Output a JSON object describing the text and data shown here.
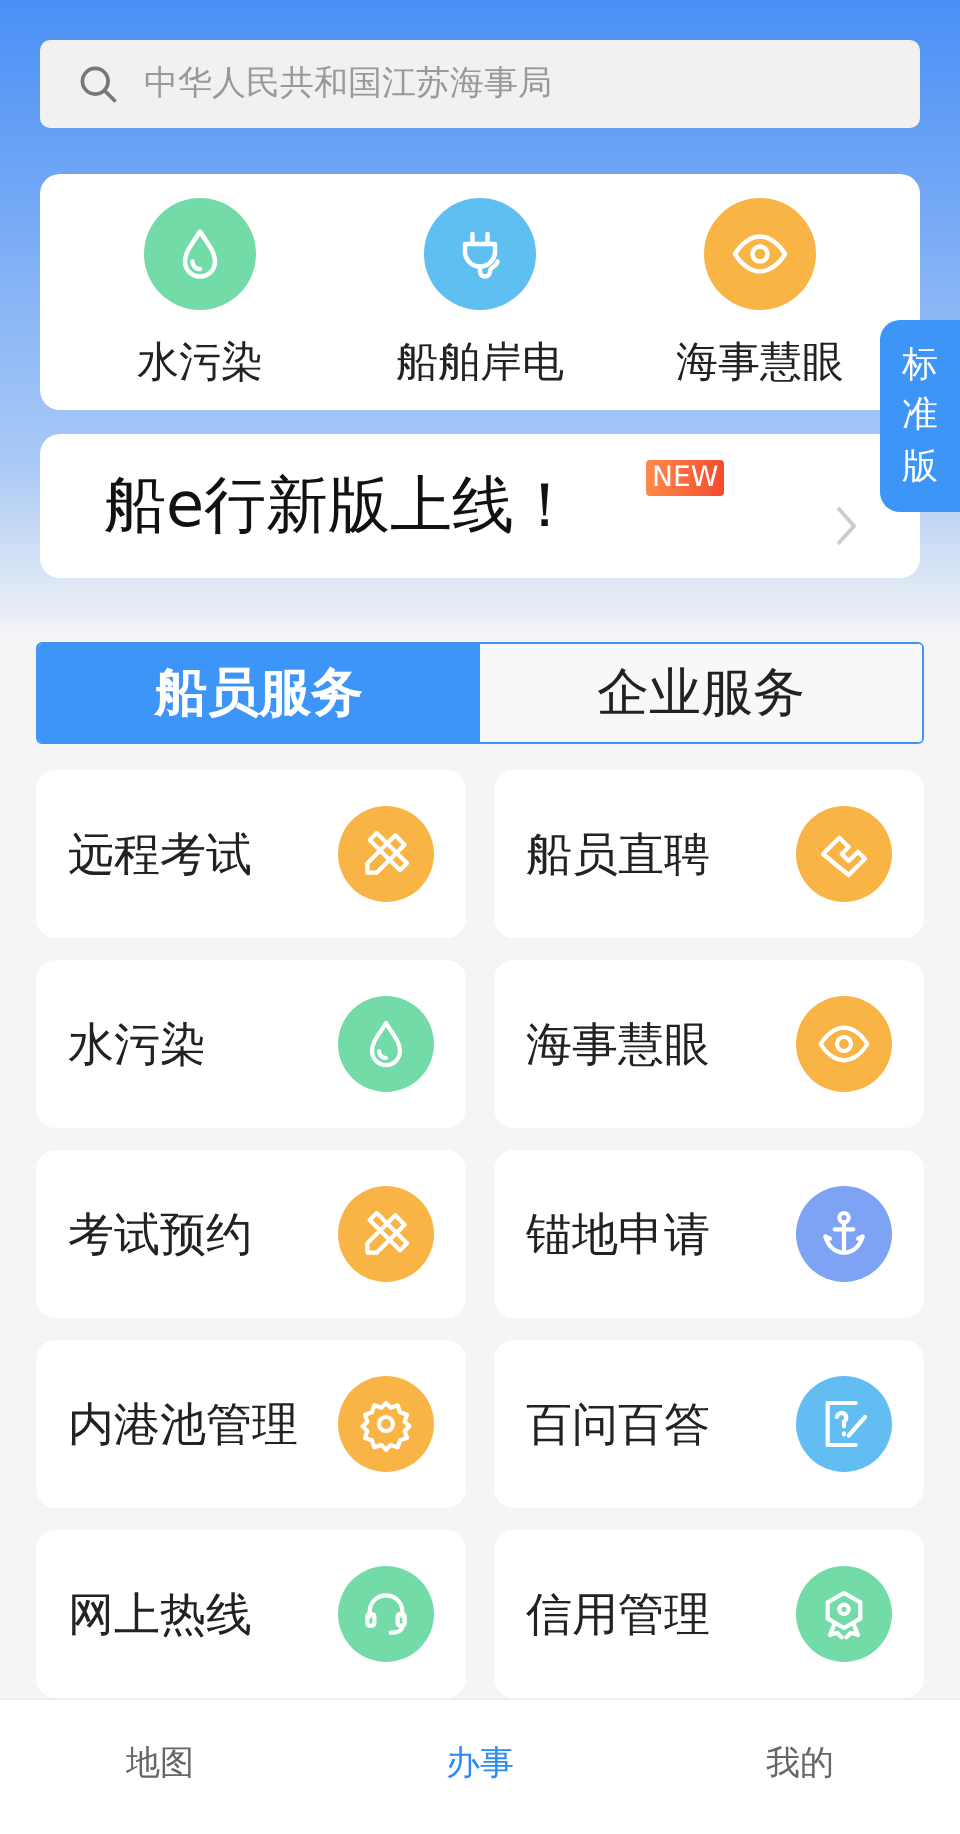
{
  "search": {
    "placeholder": "中华人民共和国江苏海事局"
  },
  "quick_items": [
    {
      "label": "水污染",
      "color": "#72dba8"
    },
    {
      "label": "船舶岸电",
      "color": "#5fbff0"
    },
    {
      "label": "海事慧眼",
      "color": "#f8b445"
    }
  ],
  "side_tab": {
    "label": "标准版"
  },
  "banner": {
    "title": "船e行新版上线！",
    "badge": "NEW"
  },
  "tabs": [
    {
      "label": "船员服务",
      "selected": true
    },
    {
      "label": "企业服务",
      "selected": false
    }
  ],
  "services": [
    {
      "label": "远程考试",
      "color": "#f8b445"
    },
    {
      "label": "船员直聘",
      "color": "#f8b445"
    },
    {
      "label": "水污染",
      "color": "#72dba8"
    },
    {
      "label": "海事慧眼",
      "color": "#f8b445"
    },
    {
      "label": "考试预约",
      "color": "#f8b445"
    },
    {
      "label": "锚地申请",
      "color": "#7ea2f4"
    },
    {
      "label": "内港池管理",
      "color": "#f8b445"
    },
    {
      "label": "百问百答",
      "color": "#62bdf2"
    },
    {
      "label": "网上热线",
      "color": "#72dba8"
    },
    {
      "label": "信用管理",
      "color": "#72dba8"
    }
  ],
  "bottom_nav": [
    {
      "label": "地图",
      "selected": false
    },
    {
      "label": "办事",
      "selected": true
    },
    {
      "label": "我的",
      "selected": false
    }
  ]
}
